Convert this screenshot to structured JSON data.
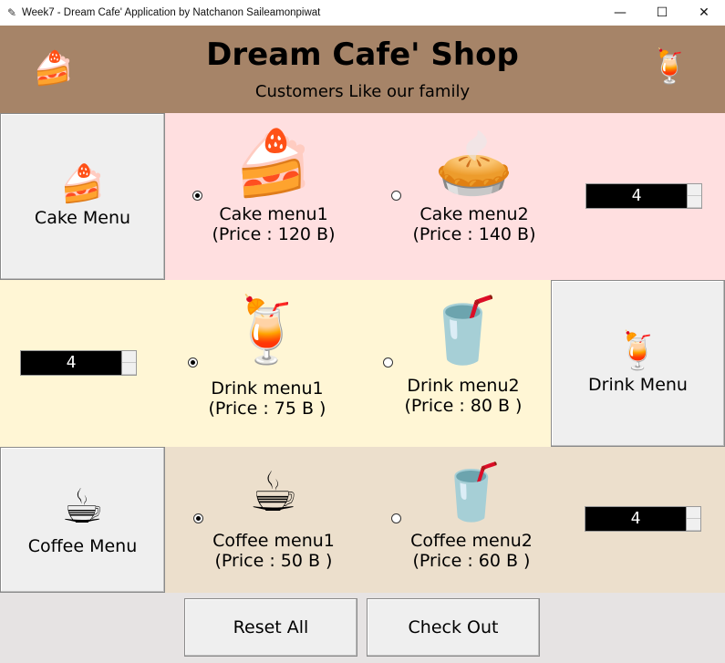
{
  "window": {
    "title": "Week7 - Dream Cafe' Application by Natchanon Saileamonpiwat",
    "minimize": "—",
    "maximize": "☐",
    "close": "✕"
  },
  "header": {
    "title": "Dream Cafe' Shop",
    "subtitle": "Customers Like our family",
    "left_icon": "🍰",
    "right_icon": "🍹"
  },
  "colors": {
    "header_bg": "#a68468",
    "cake_row_bg": "#ffdfe0",
    "drink_row_bg": "#fff6d5",
    "coffee_row_bg": "#ecdfcc"
  },
  "cake": {
    "button_label": "Cake Menu",
    "button_icon": "🍰",
    "items": [
      {
        "icon": "🍰",
        "name": "Cake menu1",
        "price": "(Price : 120 B)",
        "selected": true
      },
      {
        "icon": "🥧",
        "name": "Cake menu2",
        "price": "(Price : 140 B)",
        "selected": false
      }
    ],
    "quantity": "4"
  },
  "drink": {
    "button_label": "Drink Menu",
    "button_icon": "🍹",
    "items": [
      {
        "icon": "🍹",
        "name": "Drink menu1",
        "price": "(Price : 75 B )",
        "selected": true
      },
      {
        "icon": "🥤",
        "name": "Drink menu2",
        "price": "(Price : 80 B )",
        "selected": false
      }
    ],
    "quantity": "4"
  },
  "coffee": {
    "button_label": "Coffee Menu",
    "button_icon": "☕",
    "items": [
      {
        "icon": "☕",
        "name": "Coffee menu1",
        "price": "(Price : 50 B )",
        "selected": true
      },
      {
        "icon": "🥤",
        "name": "Coffee menu2",
        "price": "(Price : 60 B )",
        "selected": false
      }
    ],
    "quantity": "4"
  },
  "actions": {
    "reset_label": "Reset All",
    "checkout_label": "Check Out"
  }
}
